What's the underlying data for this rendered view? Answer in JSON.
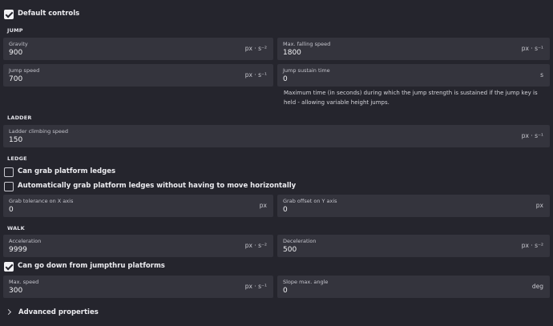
{
  "default_controls": {
    "label": "Default controls",
    "checked": true
  },
  "sections": {
    "jump": "JUMP",
    "ladder": "LADDER",
    "ledge": "LEDGE",
    "walk": "WALK"
  },
  "fields": {
    "gravity": {
      "label": "Gravity",
      "value": "900",
      "unit": "px · s⁻²"
    },
    "max_falling_speed": {
      "label": "Max. falling speed",
      "value": "1800",
      "unit": "px · s⁻¹"
    },
    "jump_speed": {
      "label": "Jump speed",
      "value": "700",
      "unit": "px · s⁻¹"
    },
    "jump_sustain_time": {
      "label": "Jump sustain time",
      "value": "0",
      "unit": "s"
    },
    "ladder_climbing_speed": {
      "label": "Ladder climbing speed",
      "value": "150",
      "unit": "px · s⁻¹"
    },
    "grab_tolerance_x": {
      "label": "Grab tolerance on X axis",
      "value": "0",
      "unit": "px"
    },
    "grab_offset_y": {
      "label": "Grab offset on Y axis",
      "value": "0",
      "unit": "px"
    },
    "acceleration": {
      "label": "Acceleration",
      "value": "9999",
      "unit": "px · s⁻²"
    },
    "deceleration": {
      "label": "Deceleration",
      "value": "500",
      "unit": "px · s⁻²"
    },
    "max_speed": {
      "label": "Max. speed",
      "value": "300",
      "unit": "px · s⁻¹"
    },
    "slope_max_angle": {
      "label": "Slope max. angle",
      "value": "0",
      "unit": "deg"
    }
  },
  "jump_sustain_help": "Maximum time (in seconds) during which the jump strength is sustained if the jump key is held - allowing variable height jumps.",
  "checkboxes": {
    "can_grab_ledges": {
      "label": "Can grab platform ledges",
      "checked": false
    },
    "auto_grab_ledges": {
      "label": "Automatically grab platform ledges without having to move horizontally",
      "checked": false
    },
    "can_go_down_jumpthru": {
      "label": "Can go down from jumpthru platforms",
      "checked": true
    }
  },
  "advanced": {
    "label": "Advanced properties"
  },
  "colors": {
    "background": "#25252d",
    "field": "#34343d",
    "text": "#e6e6ea"
  }
}
